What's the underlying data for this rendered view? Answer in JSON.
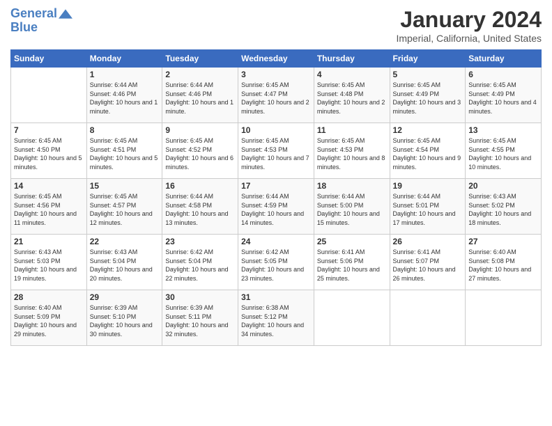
{
  "header": {
    "logo_line1": "General",
    "logo_line2": "Blue",
    "month_title": "January 2024",
    "subtitle": "Imperial, California, United States"
  },
  "columns": [
    "Sunday",
    "Monday",
    "Tuesday",
    "Wednesday",
    "Thursday",
    "Friday",
    "Saturday"
  ],
  "weeks": [
    [
      {
        "day": "",
        "sunrise": "",
        "sunset": "",
        "daylight": ""
      },
      {
        "day": "1",
        "sunrise": "Sunrise: 6:44 AM",
        "sunset": "Sunset: 4:46 PM",
        "daylight": "Daylight: 10 hours and 1 minute."
      },
      {
        "day": "2",
        "sunrise": "Sunrise: 6:44 AM",
        "sunset": "Sunset: 4:46 PM",
        "daylight": "Daylight: 10 hours and 1 minute."
      },
      {
        "day": "3",
        "sunrise": "Sunrise: 6:45 AM",
        "sunset": "Sunset: 4:47 PM",
        "daylight": "Daylight: 10 hours and 2 minutes."
      },
      {
        "day": "4",
        "sunrise": "Sunrise: 6:45 AM",
        "sunset": "Sunset: 4:48 PM",
        "daylight": "Daylight: 10 hours and 2 minutes."
      },
      {
        "day": "5",
        "sunrise": "Sunrise: 6:45 AM",
        "sunset": "Sunset: 4:49 PM",
        "daylight": "Daylight: 10 hours and 3 minutes."
      },
      {
        "day": "6",
        "sunrise": "Sunrise: 6:45 AM",
        "sunset": "Sunset: 4:49 PM",
        "daylight": "Daylight: 10 hours and 4 minutes."
      }
    ],
    [
      {
        "day": "7",
        "sunrise": "Sunrise: 6:45 AM",
        "sunset": "Sunset: 4:50 PM",
        "daylight": "Daylight: 10 hours and 5 minutes."
      },
      {
        "day": "8",
        "sunrise": "Sunrise: 6:45 AM",
        "sunset": "Sunset: 4:51 PM",
        "daylight": "Daylight: 10 hours and 5 minutes."
      },
      {
        "day": "9",
        "sunrise": "Sunrise: 6:45 AM",
        "sunset": "Sunset: 4:52 PM",
        "daylight": "Daylight: 10 hours and 6 minutes."
      },
      {
        "day": "10",
        "sunrise": "Sunrise: 6:45 AM",
        "sunset": "Sunset: 4:53 PM",
        "daylight": "Daylight: 10 hours and 7 minutes."
      },
      {
        "day": "11",
        "sunrise": "Sunrise: 6:45 AM",
        "sunset": "Sunset: 4:53 PM",
        "daylight": "Daylight: 10 hours and 8 minutes."
      },
      {
        "day": "12",
        "sunrise": "Sunrise: 6:45 AM",
        "sunset": "Sunset: 4:54 PM",
        "daylight": "Daylight: 10 hours and 9 minutes."
      },
      {
        "day": "13",
        "sunrise": "Sunrise: 6:45 AM",
        "sunset": "Sunset: 4:55 PM",
        "daylight": "Daylight: 10 hours and 10 minutes."
      }
    ],
    [
      {
        "day": "14",
        "sunrise": "Sunrise: 6:45 AM",
        "sunset": "Sunset: 4:56 PM",
        "daylight": "Daylight: 10 hours and 11 minutes."
      },
      {
        "day": "15",
        "sunrise": "Sunrise: 6:45 AM",
        "sunset": "Sunset: 4:57 PM",
        "daylight": "Daylight: 10 hours and 12 minutes."
      },
      {
        "day": "16",
        "sunrise": "Sunrise: 6:44 AM",
        "sunset": "Sunset: 4:58 PM",
        "daylight": "Daylight: 10 hours and 13 minutes."
      },
      {
        "day": "17",
        "sunrise": "Sunrise: 6:44 AM",
        "sunset": "Sunset: 4:59 PM",
        "daylight": "Daylight: 10 hours and 14 minutes."
      },
      {
        "day": "18",
        "sunrise": "Sunrise: 6:44 AM",
        "sunset": "Sunset: 5:00 PM",
        "daylight": "Daylight: 10 hours and 15 minutes."
      },
      {
        "day": "19",
        "sunrise": "Sunrise: 6:44 AM",
        "sunset": "Sunset: 5:01 PM",
        "daylight": "Daylight: 10 hours and 17 minutes."
      },
      {
        "day": "20",
        "sunrise": "Sunrise: 6:43 AM",
        "sunset": "Sunset: 5:02 PM",
        "daylight": "Daylight: 10 hours and 18 minutes."
      }
    ],
    [
      {
        "day": "21",
        "sunrise": "Sunrise: 6:43 AM",
        "sunset": "Sunset: 5:03 PM",
        "daylight": "Daylight: 10 hours and 19 minutes."
      },
      {
        "day": "22",
        "sunrise": "Sunrise: 6:43 AM",
        "sunset": "Sunset: 5:04 PM",
        "daylight": "Daylight: 10 hours and 20 minutes."
      },
      {
        "day": "23",
        "sunrise": "Sunrise: 6:42 AM",
        "sunset": "Sunset: 5:04 PM",
        "daylight": "Daylight: 10 hours and 22 minutes."
      },
      {
        "day": "24",
        "sunrise": "Sunrise: 6:42 AM",
        "sunset": "Sunset: 5:05 PM",
        "daylight": "Daylight: 10 hours and 23 minutes."
      },
      {
        "day": "25",
        "sunrise": "Sunrise: 6:41 AM",
        "sunset": "Sunset: 5:06 PM",
        "daylight": "Daylight: 10 hours and 25 minutes."
      },
      {
        "day": "26",
        "sunrise": "Sunrise: 6:41 AM",
        "sunset": "Sunset: 5:07 PM",
        "daylight": "Daylight: 10 hours and 26 minutes."
      },
      {
        "day": "27",
        "sunrise": "Sunrise: 6:40 AM",
        "sunset": "Sunset: 5:08 PM",
        "daylight": "Daylight: 10 hours and 27 minutes."
      }
    ],
    [
      {
        "day": "28",
        "sunrise": "Sunrise: 6:40 AM",
        "sunset": "Sunset: 5:09 PM",
        "daylight": "Daylight: 10 hours and 29 minutes."
      },
      {
        "day": "29",
        "sunrise": "Sunrise: 6:39 AM",
        "sunset": "Sunset: 5:10 PM",
        "daylight": "Daylight: 10 hours and 30 minutes."
      },
      {
        "day": "30",
        "sunrise": "Sunrise: 6:39 AM",
        "sunset": "Sunset: 5:11 PM",
        "daylight": "Daylight: 10 hours and 32 minutes."
      },
      {
        "day": "31",
        "sunrise": "Sunrise: 6:38 AM",
        "sunset": "Sunset: 5:12 PM",
        "daylight": "Daylight: 10 hours and 34 minutes."
      },
      {
        "day": "",
        "sunrise": "",
        "sunset": "",
        "daylight": ""
      },
      {
        "day": "",
        "sunrise": "",
        "sunset": "",
        "daylight": ""
      },
      {
        "day": "",
        "sunrise": "",
        "sunset": "",
        "daylight": ""
      }
    ]
  ]
}
